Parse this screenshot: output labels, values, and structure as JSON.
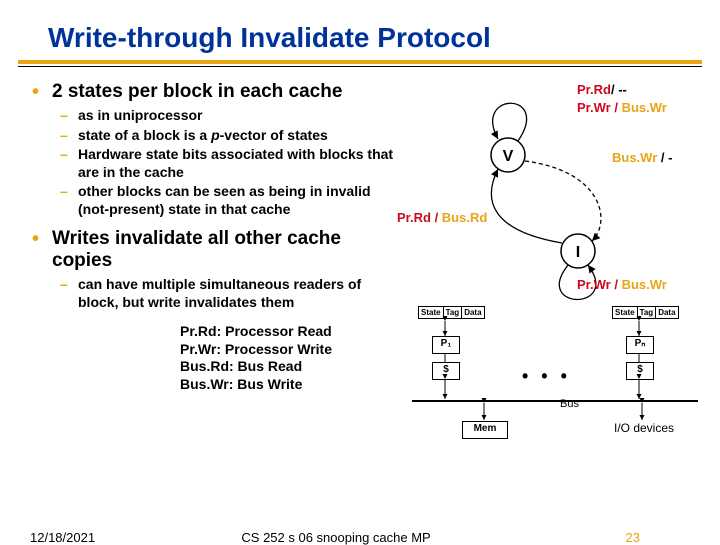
{
  "title": "Write-through Invalidate Protocol",
  "bullets": {
    "b1": "2 states per block in each cache",
    "b1_subs": {
      "s1": "as in uniprocessor",
      "s2a": "state of a block is a ",
      "s2b": "p",
      "s2c": "-vector of states",
      "s3": "Hardware state bits associated with blocks that are in the cache",
      "s4": "other blocks can be seen as being in invalid (not-present) state in that cache"
    },
    "b2": "Writes invalidate all other cache copies",
    "b2_subs": {
      "s1": "can have multiple simultaneous readers of block, but write invalidates them"
    }
  },
  "abbrevs": {
    "a1": "Pr.Rd: Processor Read",
    "a2": "Pr.Wr: Processor Write",
    "a3": "Bus.Rd: Bus Read",
    "a4": "Bus.Wr: Bus Write"
  },
  "state_diagram": {
    "v": "V",
    "i": "I",
    "top1": "Pr.Rd",
    "top1b": "/ --",
    "top2a": "Pr.Wr / ",
    "top2b": "Bus.Wr",
    "right": "Bus.Wr",
    "right2": " / -",
    "mid": "Pr.Rd / ",
    "mid2": "Bus.Rd",
    "bot": "Pr.Wr / ",
    "bot2": "Bus.Wr"
  },
  "bus": {
    "hdr_state": "State",
    "hdr_tag": "Tag",
    "hdr_data": "Data",
    "p1": "P₁",
    "pn": "Pₙ",
    "cache": "$",
    "mem": "Mem",
    "bus_label": "Bus",
    "io": "I/O devices",
    "dots": "• • •"
  },
  "footer": {
    "date": "12/18/2021",
    "mid": "CS 252 s 06 snooping cache MP",
    "page": "23"
  }
}
